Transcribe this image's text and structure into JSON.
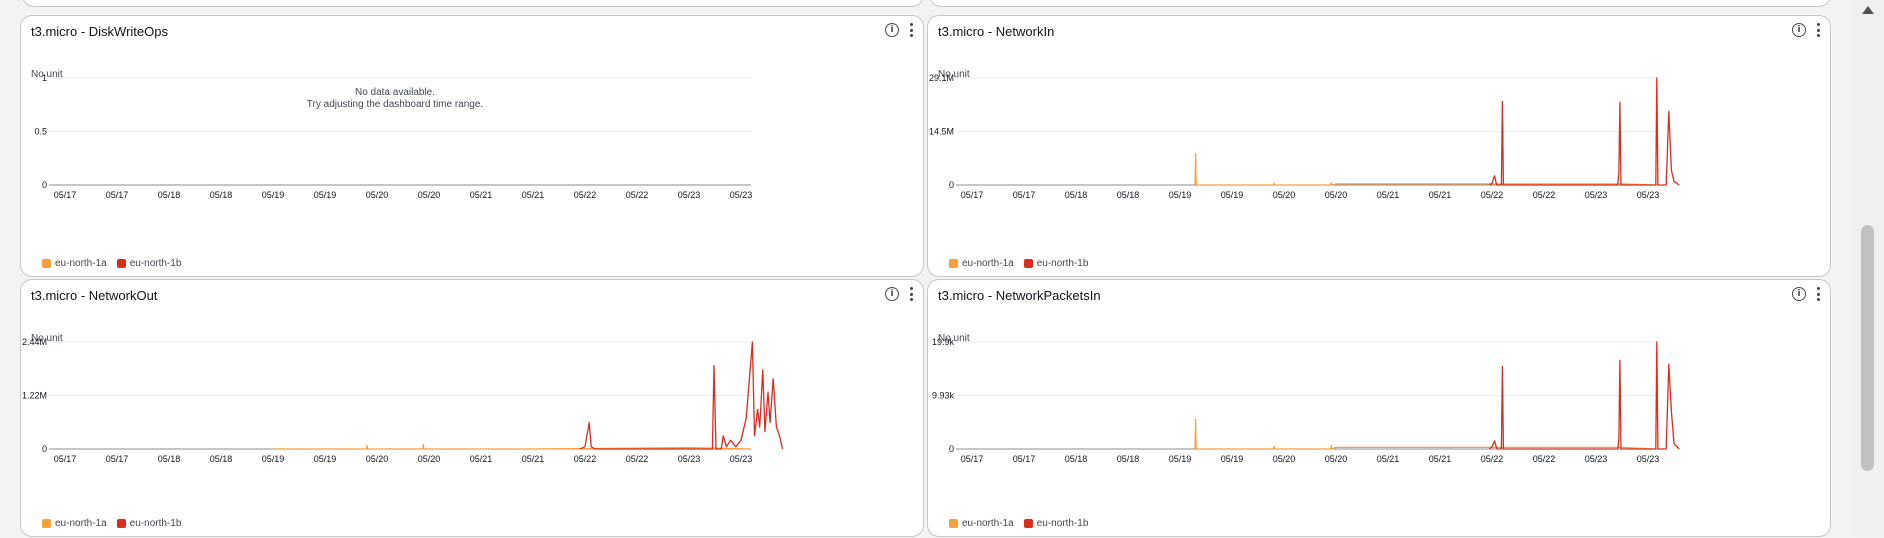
{
  "no_data": {
    "line1": "No data available.",
    "line2": "Try adjusting the dashboard time range."
  },
  "legend": [
    {
      "label": "eu-north-1a",
      "color": "#f89f3d"
    },
    {
      "label": "eu-north-1b",
      "color": "#d82d1f"
    }
  ],
  "chart_data": [
    {
      "type": "line",
      "title": "t3.micro - DiskWriteOps",
      "ylabel": "No unit",
      "ylim": [
        0,
        1
      ],
      "yticks": [
        "1",
        "0.5",
        "0"
      ],
      "ytick_values": [
        1,
        0.5,
        0
      ],
      "xticks": [
        "05/17",
        "05/17",
        "05/18",
        "05/18",
        "05/19",
        "05/19",
        "05/20",
        "05/20",
        "05/21",
        "05/21",
        "05/22",
        "05/22",
        "05/23",
        "05/23"
      ],
      "series": [
        {
          "name": "eu-north-1a",
          "color": "#f89f3d",
          "points": []
        },
        {
          "name": "eu-north-1b",
          "color": "#d82d1f",
          "points": []
        }
      ],
      "no_data": true
    },
    {
      "type": "line",
      "title": "t3.micro - NetworkIn",
      "ylabel": "No unit",
      "ylim": [
        0,
        29.1
      ],
      "yticks": [
        "29.1M",
        "14.5M",
        "0"
      ],
      "ytick_values": [
        29.1,
        14.5,
        0
      ],
      "xticks": [
        "05/17",
        "05/17",
        "05/18",
        "05/18",
        "05/19",
        "05/19",
        "05/20",
        "05/20",
        "05/21",
        "05/21",
        "05/22",
        "05/22",
        "05/23",
        "05/23"
      ],
      "series": [
        {
          "name": "eu-north-1a",
          "color": "#f89f3d",
          "points": [
            [
              4.28,
              0
            ],
            [
              4.29,
              0.3
            ],
            [
              4.3,
              8.5
            ],
            [
              4.31,
              0.3
            ],
            [
              4.32,
              0
            ],
            [
              5.8,
              0
            ],
            [
              5.81,
              0.5
            ],
            [
              5.82,
              0
            ],
            [
              6.9,
              0
            ],
            [
              6.91,
              0.6
            ],
            [
              6.92,
              0
            ],
            [
              7.0,
              0.3
            ],
            [
              10.0,
              0.3
            ],
            [
              12.5,
              0.3
            ],
            [
              13.1,
              0
            ]
          ]
        },
        {
          "name": "eu-north-1b",
          "color": "#d82d1f",
          "points": [
            [
              9.95,
              0
            ],
            [
              10.0,
              0.5
            ],
            [
              10.05,
              2.5
            ],
            [
              10.08,
              0.5
            ],
            [
              10.1,
              0
            ],
            [
              10.18,
              0
            ],
            [
              10.2,
              22.7
            ],
            [
              10.22,
              0
            ],
            [
              10.3,
              0
            ],
            [
              12.42,
              0
            ],
            [
              12.44,
              3.5
            ],
            [
              12.46,
              22.5
            ],
            [
              12.48,
              0
            ],
            [
              12.5,
              0
            ],
            [
              13.15,
              0
            ],
            [
              13.17,
              29.1
            ],
            [
              13.19,
              0
            ],
            [
              13.35,
              0
            ],
            [
              13.4,
              20
            ],
            [
              13.45,
              4
            ],
            [
              13.5,
              1
            ],
            [
              13.6,
              0
            ]
          ]
        }
      ]
    },
    {
      "type": "line",
      "title": "t3.micro - NetworkOut",
      "ylabel": "No unit",
      "ylim": [
        0,
        2.44
      ],
      "yticks": [
        "2.44M",
        "1.22M",
        "0"
      ],
      "ytick_values": [
        2.44,
        1.22,
        0
      ],
      "xticks": [
        "05/17",
        "05/17",
        "05/18",
        "05/18",
        "05/19",
        "05/19",
        "05/20",
        "05/20",
        "05/21",
        "05/21",
        "05/22",
        "05/22",
        "05/23",
        "05/23"
      ],
      "series": [
        {
          "name": "eu-north-1a",
          "color": "#f89f3d",
          "points": [
            [
              4.0,
              0
            ],
            [
              5.8,
              0
            ],
            [
              5.81,
              0.08
            ],
            [
              5.82,
              0
            ],
            [
              6.88,
              0
            ],
            [
              6.89,
              0.1
            ],
            [
              6.9,
              0
            ],
            [
              9.0,
              0
            ],
            [
              12.0,
              0.03
            ],
            [
              13.2,
              0
            ]
          ]
        },
        {
          "name": "eu-north-1b",
          "color": "#d82d1f",
          "points": [
            [
              9.9,
              0
            ],
            [
              10.0,
              0.05
            ],
            [
              10.08,
              0.6
            ],
            [
              10.12,
              0.05
            ],
            [
              10.2,
              0
            ],
            [
              12.3,
              0
            ],
            [
              12.45,
              0
            ],
            [
              12.48,
              1.9
            ],
            [
              12.52,
              0
            ],
            [
              12.62,
              0
            ],
            [
              12.66,
              0.3
            ],
            [
              12.72,
              0.05
            ],
            [
              12.8,
              0.2
            ],
            [
              12.9,
              0.05
            ],
            [
              13.0,
              0.2
            ],
            [
              13.1,
              0.7
            ],
            [
              13.22,
              2.44
            ],
            [
              13.26,
              0.3
            ],
            [
              13.32,
              0.9
            ],
            [
              13.36,
              0.5
            ],
            [
              13.42,
              1.8
            ],
            [
              13.46,
              0.4
            ],
            [
              13.52,
              1.3
            ],
            [
              13.56,
              0.6
            ],
            [
              13.62,
              1.6
            ],
            [
              13.68,
              0.5
            ],
            [
              13.74,
              0.3
            ],
            [
              13.8,
              0
            ]
          ]
        }
      ]
    },
    {
      "type": "line",
      "title": "t3.micro - NetworkPacketsIn",
      "ylabel": "No unit",
      "ylim": [
        0,
        19.9
      ],
      "yticks": [
        "19.9k",
        "9.93k",
        "0"
      ],
      "ytick_values": [
        19.9,
        9.93,
        0
      ],
      "xticks": [
        "05/17",
        "05/17",
        "05/18",
        "05/18",
        "05/19",
        "05/19",
        "05/20",
        "05/20",
        "05/21",
        "05/21",
        "05/22",
        "05/22",
        "05/23",
        "05/23"
      ],
      "series": [
        {
          "name": "eu-north-1a",
          "color": "#f89f3d",
          "points": [
            [
              4.28,
              0
            ],
            [
              4.29,
              0.3
            ],
            [
              4.3,
              5.5
            ],
            [
              4.31,
              0.3
            ],
            [
              4.32,
              0
            ],
            [
              5.8,
              0
            ],
            [
              5.81,
              0.5
            ],
            [
              5.82,
              0
            ],
            [
              6.9,
              0
            ],
            [
              6.91,
              0.6
            ],
            [
              6.92,
              0
            ],
            [
              7.0,
              0.3
            ],
            [
              10.0,
              0.3
            ],
            [
              12.5,
              0.3
            ],
            [
              13.1,
              0
            ]
          ]
        },
        {
          "name": "eu-north-1b",
          "color": "#d82d1f",
          "points": [
            [
              9.95,
              0
            ],
            [
              10.0,
              0.4
            ],
            [
              10.05,
              1.5
            ],
            [
              10.08,
              0.4
            ],
            [
              10.1,
              0
            ],
            [
              10.18,
              0
            ],
            [
              10.2,
              15.3
            ],
            [
              10.22,
              0
            ],
            [
              10.3,
              0
            ],
            [
              12.42,
              0
            ],
            [
              12.44,
              2
            ],
            [
              12.46,
              16.5
            ],
            [
              12.48,
              0
            ],
            [
              12.5,
              0
            ],
            [
              13.15,
              0
            ],
            [
              13.17,
              19.9
            ],
            [
              13.19,
              0
            ],
            [
              13.35,
              0
            ],
            [
              13.4,
              15.8
            ],
            [
              13.45,
              7
            ],
            [
              13.5,
              1
            ],
            [
              13.6,
              0
            ]
          ]
        }
      ]
    }
  ]
}
